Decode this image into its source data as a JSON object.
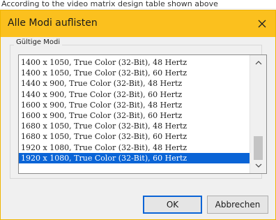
{
  "background_text": "According to the video matrix design table shown above",
  "dialog": {
    "title": "Alle Modi auflisten",
    "close_icon": "close-icon",
    "group_label": "Gültige Modi",
    "modes": [
      "1400 x 1050, True Color (32-Bit), 48 Hertz",
      "1400 x 1050, True Color (32-Bit), 60 Hertz",
      "1440 x 900, True Color (32-Bit), 48 Hertz",
      "1440 x 900, True Color (32-Bit), 60 Hertz",
      "1600 x 900, True Color (32-Bit), 48 Hertz",
      "1600 x 900, True Color (32-Bit), 60 Hertz",
      "1680 x 1050, True Color (32-Bit), 48 Hertz",
      "1680 x 1050, True Color (32-Bit), 60 Hertz",
      "1920 x 1080, True Color (32-Bit), 48 Hertz",
      "1920 x 1080, True Color (32-Bit), 60 Hertz"
    ],
    "selected_index": 9,
    "scroll_up_icon": "chevron-up-icon",
    "scroll_down_icon": "chevron-down-icon",
    "ok_label": "OK",
    "cancel_label": "Abbrechen",
    "colors": {
      "title_bar": "#fbc01e",
      "selection": "#0a64d6"
    }
  }
}
